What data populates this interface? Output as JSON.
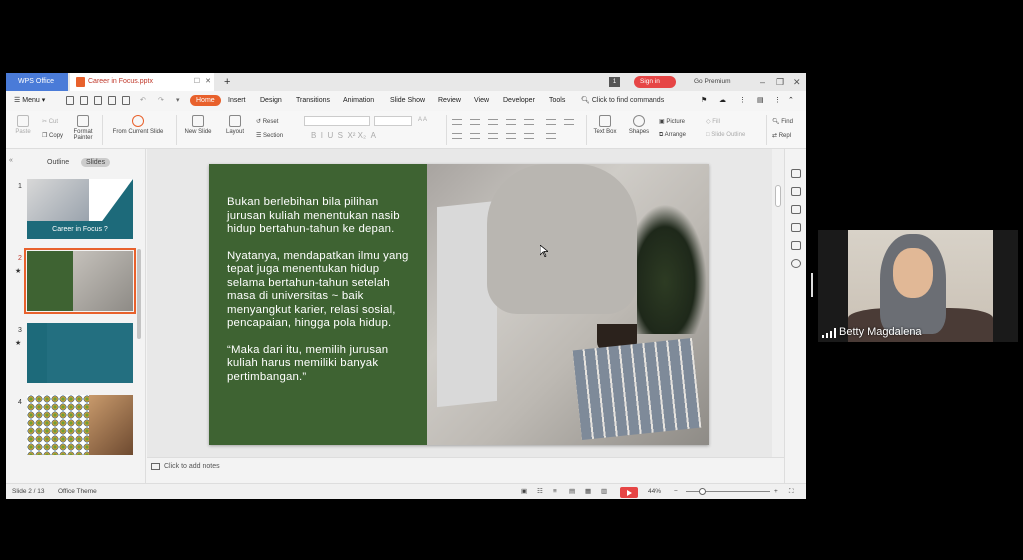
{
  "window": {
    "app_tab": "WPS Office",
    "doc_tab": "Career in Focus.pptx",
    "page_badge": "1",
    "signin": "Sign in",
    "premium": "Go Premium"
  },
  "menubar": {
    "menu": "Menu",
    "tabs": [
      "Home",
      "Insert",
      "Design",
      "Transitions",
      "Animation",
      "Slide Show",
      "Review",
      "View",
      "Developer",
      "Tools"
    ],
    "search": "Click to find commands"
  },
  "ribbon": {
    "paste": "Paste",
    "cut": "Cut",
    "copy": "Copy",
    "format_painter": "Format Painter",
    "from_current": "From Current Slide",
    "new_slide": "New Slide",
    "layout": "Layout",
    "reset": "Reset",
    "section": "Section",
    "text_box": "Text Box",
    "shapes": "Shapes",
    "picture": "Picture",
    "arrange": "Arrange",
    "fill": "Fill",
    "slide_outline": "Slide Outline",
    "find": "Find",
    "replace": "Repl"
  },
  "left_panel": {
    "outline_tab": "Outline",
    "slides_tab": "Slides",
    "thumbs": [
      "1",
      "2",
      "3",
      "4"
    ],
    "thumb1_title": "Career in Focus ?"
  },
  "slide": {
    "paragraphs": [
      "Bukan berlebihan bila pilihan jurusan kuliah menentukan nasib hidup bertahun-tahun ke depan.",
      "Nyatanya, mendapatkan ilmu yang tepat juga menentukan hidup selama bertahun-tahun setelah masa di universitas ~ baik menyangkut karier, relasi sosial, pencapaian, hingga pola hidup.",
      "“Maka dari itu, memilih jurusan kuliah harus memiliki banyak pertimbangan.”"
    ]
  },
  "notes": {
    "placeholder": "Click to add notes"
  },
  "status": {
    "slide_count": "Slide 2 / 13",
    "theme": "Office Theme",
    "zoom": "44%"
  },
  "webcam": {
    "name": "Betty Magdalena"
  },
  "colors": {
    "accent": "#e8612c",
    "slide_green": "#3e6332",
    "wps_blue": "#4a7bd8"
  }
}
